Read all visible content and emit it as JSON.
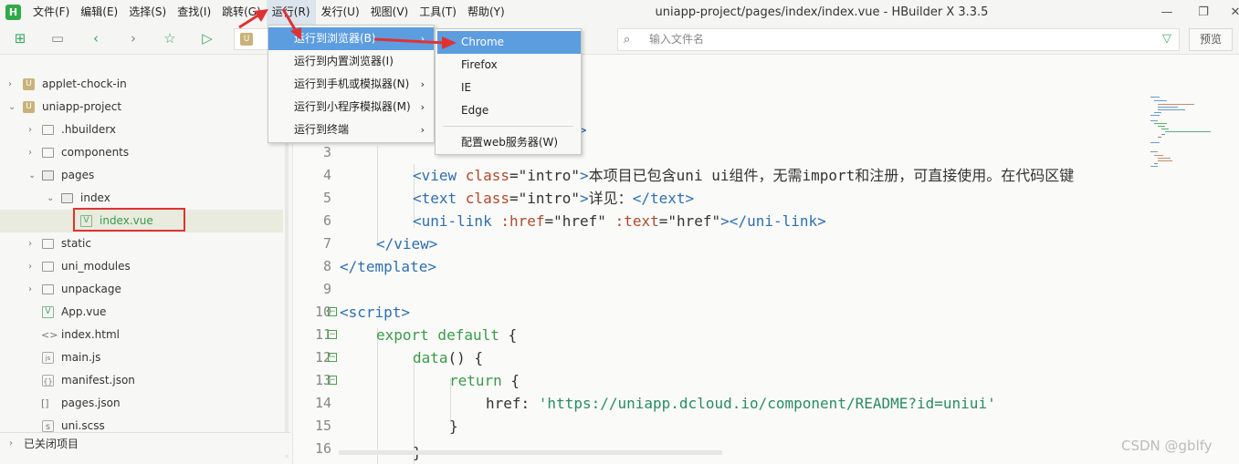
{
  "menubar": {
    "logo": "H",
    "items": [
      "文件(F)",
      "编辑(E)",
      "选择(S)",
      "查找(I)",
      "跳转(G)",
      "运行(R)",
      "发行(U)",
      "视图(V)",
      "工具(T)",
      "帮助(Y)"
    ],
    "active_index": 5
  },
  "window": {
    "title": "uniapp-project/pages/index/index.vue - HBuilder X 3.3.5",
    "minimize": "—",
    "maximize": "❐",
    "close": "✕"
  },
  "toolbar": {
    "file_search_placeholder": "输入文件名",
    "preview_label": "预览",
    "file_badge": "U"
  },
  "sidebar": {
    "items": [
      {
        "label": "applet-chock-in",
        "arrow": "›",
        "icon": "U"
      },
      {
        "label": "uniapp-project",
        "arrow": "⌄",
        "icon": "U"
      },
      {
        "label": ".hbuilderx",
        "arrow": "›"
      },
      {
        "label": "components",
        "arrow": "›"
      },
      {
        "label": "pages",
        "arrow": "⌄"
      },
      {
        "label": "index",
        "arrow": "⌄"
      },
      {
        "label": "index.vue",
        "icon": "V"
      },
      {
        "label": "static",
        "arrow": "›"
      },
      {
        "label": "uni_modules",
        "arrow": "›"
      },
      {
        "label": "unpackage",
        "arrow": "›"
      },
      {
        "label": "App.vue",
        "icon": "V"
      },
      {
        "label": "index.html",
        "icon": "<>"
      },
      {
        "label": "main.js",
        "icon": "js"
      },
      {
        "label": "manifest.json",
        "icon": "{}"
      },
      {
        "label": "pages.json",
        "icon": "[]"
      },
      {
        "label": "uni.scss",
        "icon": "s"
      }
    ],
    "footer": {
      "arrow": "›",
      "label": "已关闭项目"
    }
  },
  "editor": {
    "line_numbers": [
      "3",
      "4",
      "5",
      "6",
      "7",
      "8",
      "9",
      "10",
      "11",
      "12",
      "13",
      "14",
      "15",
      "16"
    ],
    "fold_marker": "⊟",
    "partial_top": ">",
    "lines": {
      "l4": {
        "p1": "<view ",
        "p2": "class",
        "p3": "=\"intro\"",
        "p4": ">",
        "p5": "本项目已包含uni ui组件，无需import和注册，可直接使用。在代码区键"
      },
      "l5": {
        "p1": "<text ",
        "p2": "class",
        "p3": "=\"intro\"",
        "p4": ">",
        "p5": "详见：",
        "p6": "</text>"
      },
      "l6": {
        "p1": "<uni-link ",
        "p2": ":href",
        "p3": "=\"href\" ",
        "p4": ":text",
        "p5": "=\"href\"",
        "p6": "></uni-link>"
      },
      "l7": "</view>",
      "l8": "</template>",
      "l10": "<script>",
      "l11": {
        "p1": "export default",
        "p2": " {"
      },
      "l12": {
        "p1": "data",
        "p2": "() {"
      },
      "l13": {
        "p1": "return",
        "p2": " {"
      },
      "l14": {
        "p1": "href: ",
        "p2": "'https://uniapp.dcloud.io/component/README?id=uniui'"
      },
      "l15": "}",
      "l16": "}"
    }
  },
  "run_menu": {
    "items": [
      {
        "label": "运行到浏览器(B)",
        "submenu": "›"
      },
      {
        "label": "运行到内置浏览器(I)"
      },
      {
        "label": "运行到手机或模拟器(N)",
        "submenu": "›"
      },
      {
        "label": "运行到小程序模拟器(M)",
        "submenu": "›"
      },
      {
        "label": "运行到终端",
        "submenu": "›"
      }
    ]
  },
  "browser_menu": {
    "items": [
      "Chrome",
      "Firefox",
      "IE",
      "Edge"
    ],
    "config": "配置web服务器(W)"
  },
  "watermark": "CSDN @gblfy",
  "colors": {
    "accent": "#5c9de0",
    "annotation": "#e03232",
    "brand": "#2faa48"
  }
}
